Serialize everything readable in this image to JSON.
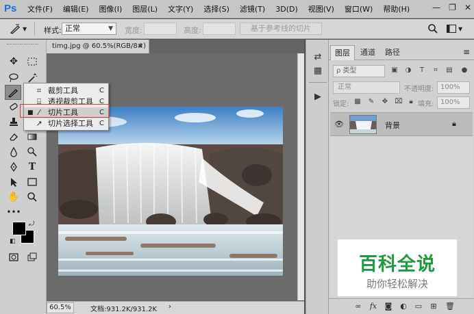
{
  "app": {
    "logo": "Ps"
  },
  "menu": [
    "文件(F)",
    "编辑(E)",
    "图像(I)",
    "图层(L)",
    "文字(Y)",
    "选择(S)",
    "滤镜(T)",
    "3D(D)",
    "视图(V)",
    "窗口(W)",
    "帮助(H)"
  ],
  "window_controls": {
    "minimize": "—",
    "restore": "❐",
    "close": "✕"
  },
  "options_bar": {
    "style_label": "样式:",
    "style_value": "正常",
    "width_label": "宽度:",
    "height_label": "高度:",
    "slices_from_guides": "基于参考线的切片"
  },
  "document": {
    "tab_title": "timg.jpg @ 60.5%(RGB/8#)",
    "tab_close": "×",
    "zoom": "60.5%",
    "doc_size": "文档:931.2K/931.2K",
    "status_arrow": "›"
  },
  "flyout": {
    "items": [
      {
        "label": "裁剪工具",
        "key": "C",
        "icon": "crop-icon",
        "selected": false
      },
      {
        "label": "透视裁剪工具",
        "key": "C",
        "icon": "perspective-crop-icon",
        "selected": false
      },
      {
        "label": "切片工具",
        "key": "C",
        "icon": "slice-icon",
        "selected": true
      },
      {
        "label": "切片选择工具",
        "key": "C",
        "icon": "slice-select-icon",
        "selected": false
      }
    ]
  },
  "layers_panel": {
    "tabs": [
      "图层",
      "通道",
      "路径"
    ],
    "kind_filter": "ρ 类型",
    "blend_mode": "正常",
    "opacity_label": "不透明度:",
    "opacity_value": "100%",
    "lock_label": "锁定:",
    "fill_label": "填充:",
    "fill_value": "100%",
    "layers": [
      {
        "name": "背景",
        "visible": true,
        "locked": true
      }
    ]
  },
  "watermark": {
    "title": "百科全说",
    "subtitle": "助你轻松解决"
  },
  "colors": {
    "foreground": "#000000",
    "background": "#000000",
    "accent": "#1473e6",
    "highlight_box": "#d43c3c",
    "watermark_green": "#1f9a3e"
  }
}
